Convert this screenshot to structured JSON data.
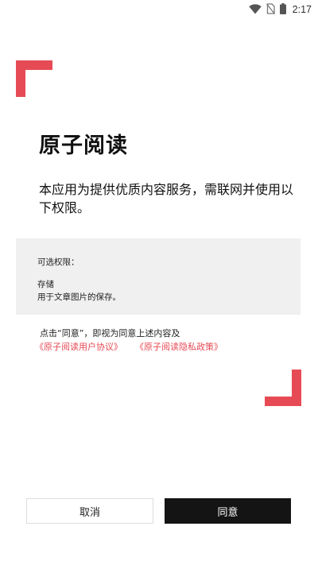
{
  "status_bar": {
    "time": "2:17",
    "icons": [
      "wifi-icon",
      "no-sim-icon",
      "battery-icon"
    ]
  },
  "dialog": {
    "title": "原子阅读",
    "intro": "本应用为提供优质内容服务，需联网并使用以下权限。",
    "permissions": {
      "heading": "可选权限：",
      "items": [
        {
          "name": "存储",
          "description": "用于文章图片的保存。"
        }
      ]
    },
    "consent_note": "点击“同意”，即视为同意上述内容及",
    "links": {
      "user_agreement": "《原子阅读用户协议》",
      "privacy_policy": "《原子阅读隐私政策》"
    },
    "buttons": {
      "cancel": "取消",
      "agree": "同意"
    }
  },
  "colors": {
    "accent": "#e64b55",
    "primary_button": "#141414",
    "panel_background": "#f0f0f0"
  }
}
